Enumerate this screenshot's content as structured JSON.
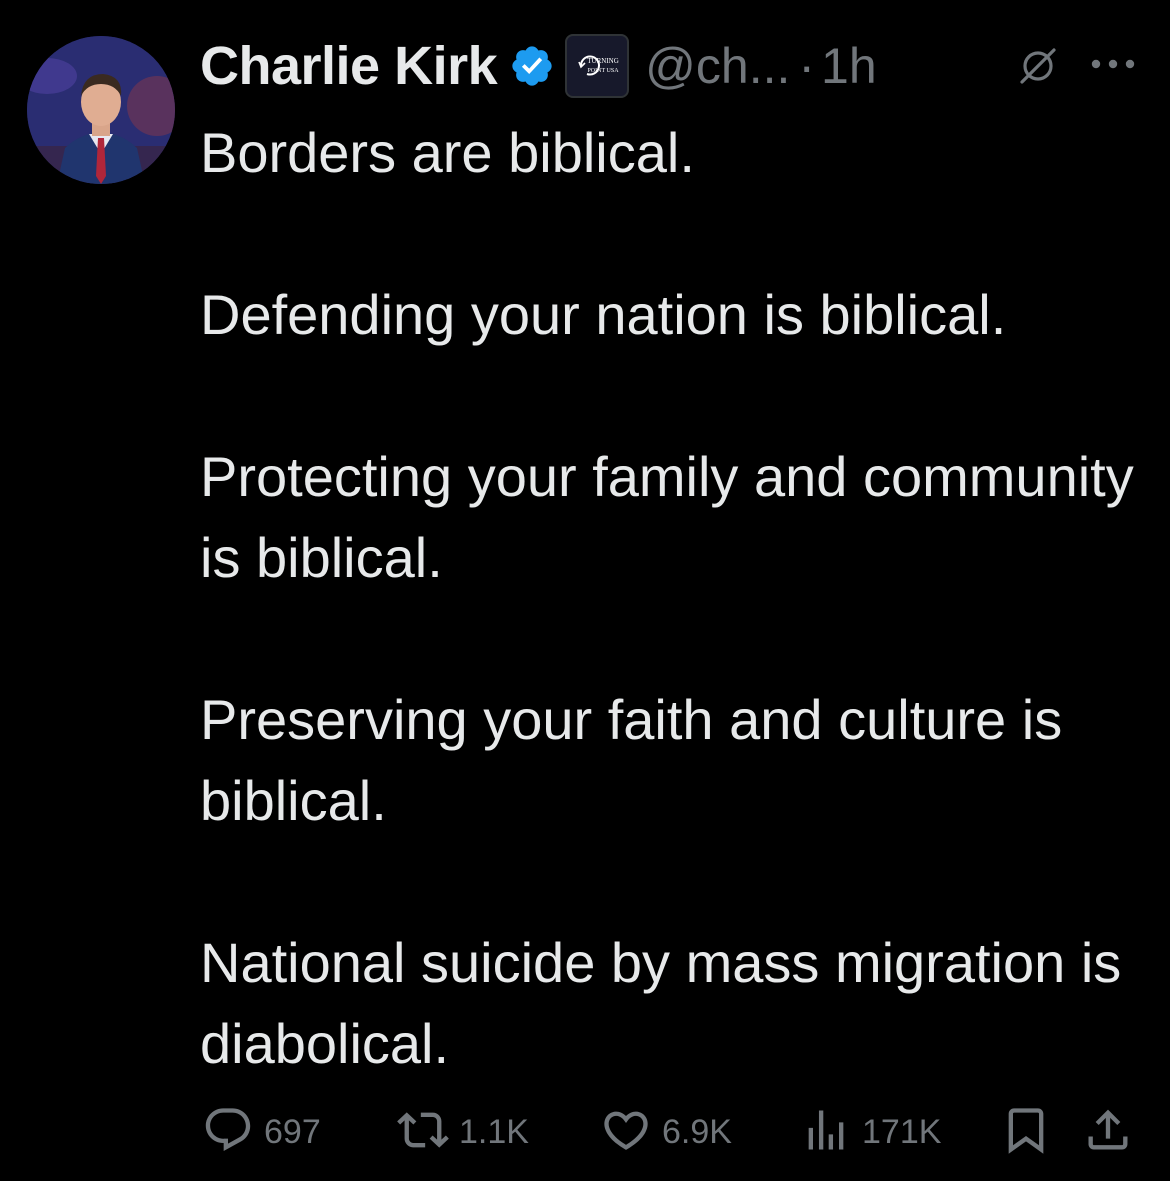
{
  "tweet": {
    "author": {
      "display_name": "Charlie Kirk",
      "handle": "@ch...",
      "verified_icon": "verified-badge-icon",
      "affiliate_badge_text_1": "TURNING",
      "affiliate_badge_text_2": "POINT USA"
    },
    "separator": "·",
    "time": "1h",
    "paragraphs": [
      "Borders are biblical.",
      "Defending your nation is biblical.",
      "Protecting your family and community is biblical.",
      "Preserving your faith and culture is biblical.",
      "National suicide by mass migration is diabolical."
    ],
    "actions": {
      "replies": "697",
      "reposts": "1.1K",
      "likes": "6.9K",
      "views": "171K"
    }
  },
  "colors": {
    "background": "#000000",
    "text": "#e7e9ea",
    "secondary": "#71767b",
    "verified": "#1d9bf0"
  }
}
